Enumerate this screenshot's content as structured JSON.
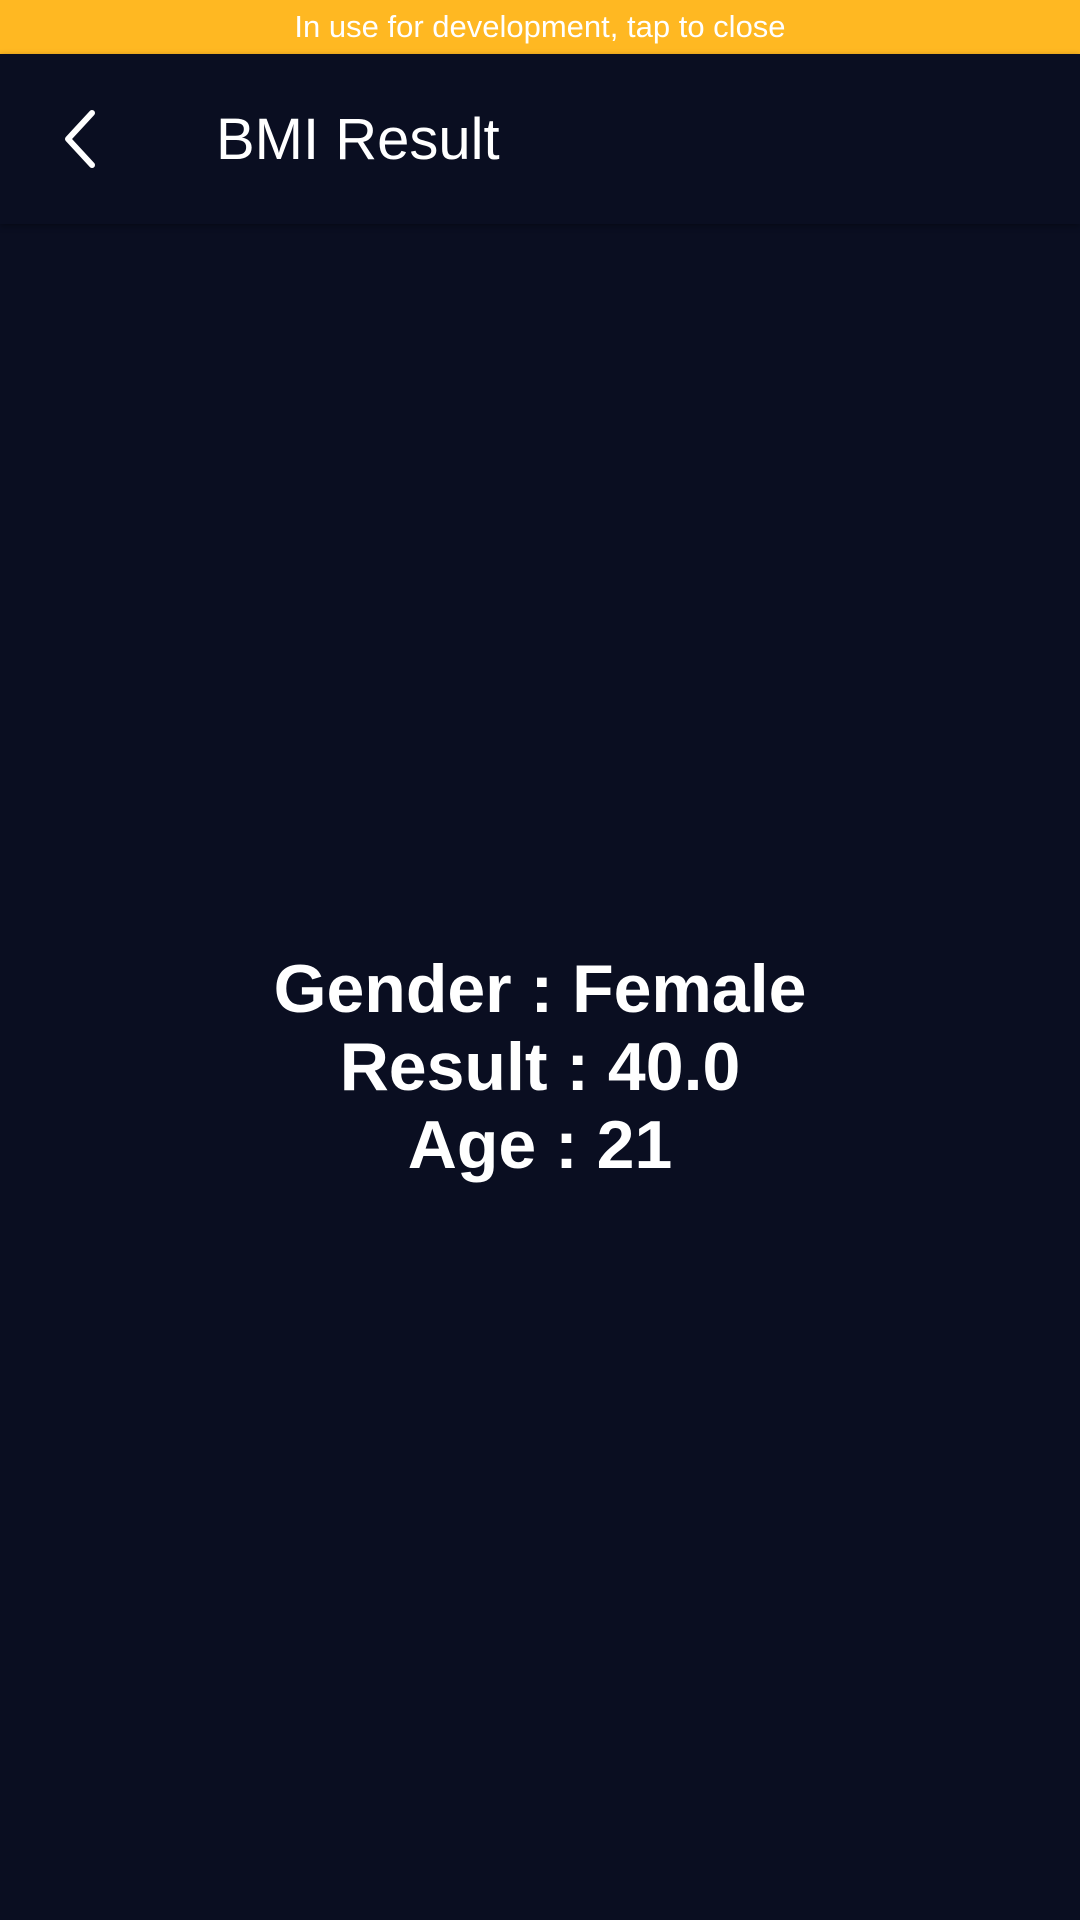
{
  "dev_banner": {
    "text": "In use for development, tap to close",
    "color": "#ffb822"
  },
  "app_bar": {
    "title": "BMI Result",
    "back_icon": "chevron-left-icon",
    "background": "#0a0e21"
  },
  "result": {
    "gender": "Gender : Female",
    "score": "Result : 40.0",
    "age": "Age : 21"
  }
}
